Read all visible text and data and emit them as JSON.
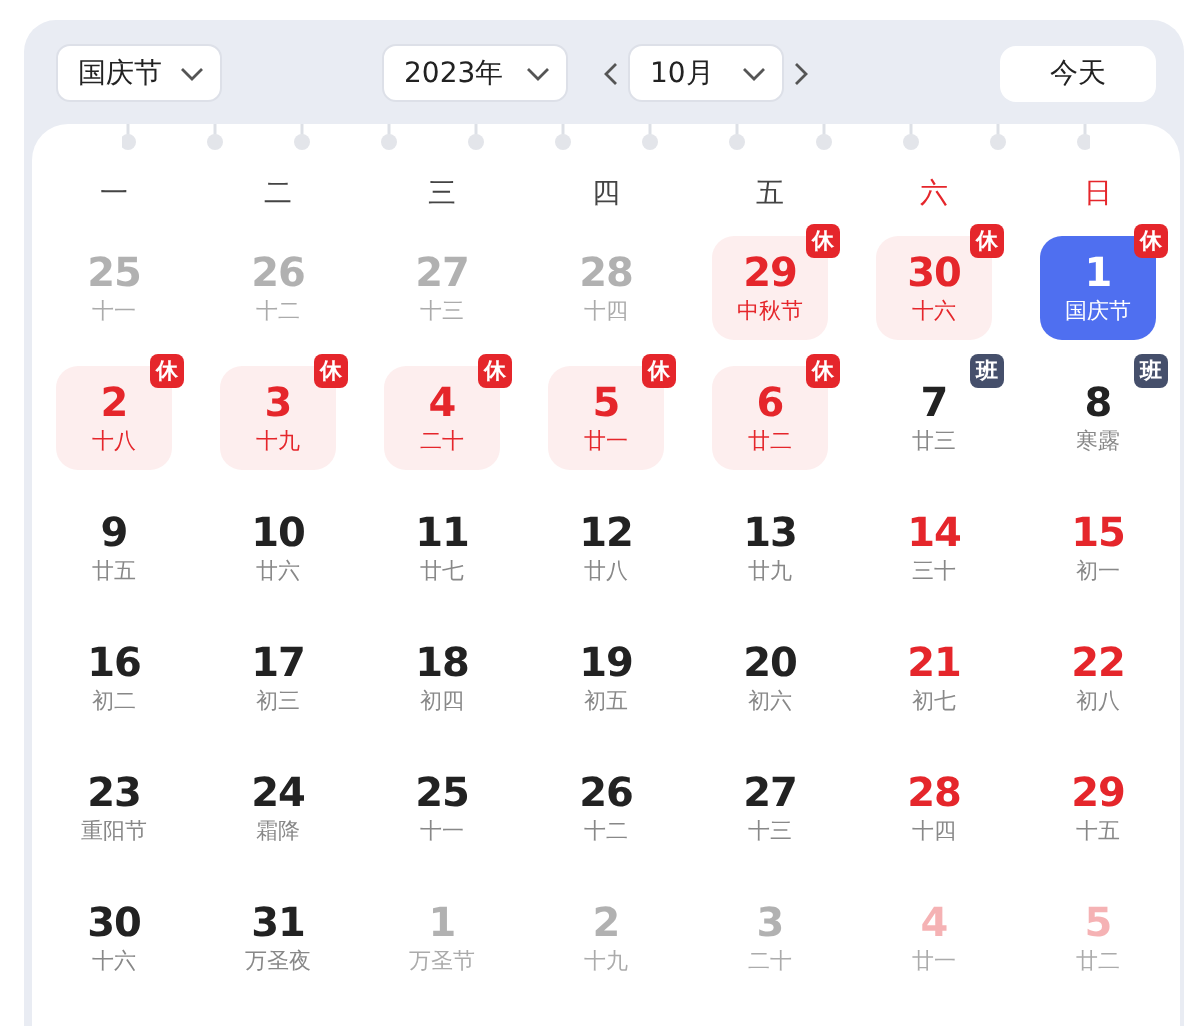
{
  "toolbar": {
    "holiday_select": "国庆节",
    "year_select": "2023年",
    "month_select": "10月",
    "today_button": "今天"
  },
  "weekdays": [
    {
      "label": "一",
      "weekend": false
    },
    {
      "label": "二",
      "weekend": false
    },
    {
      "label": "三",
      "weekend": false
    },
    {
      "label": "四",
      "weekend": false
    },
    {
      "label": "五",
      "weekend": false
    },
    {
      "label": "六",
      "weekend": true
    },
    {
      "label": "日",
      "weekend": true
    }
  ],
  "days": [
    {
      "day": "25",
      "lunar": "十一",
      "in_month": false,
      "weekend": false,
      "holiday": false,
      "selected": false
    },
    {
      "day": "26",
      "lunar": "十二",
      "in_month": false,
      "weekend": false,
      "holiday": false,
      "selected": false
    },
    {
      "day": "27",
      "lunar": "十三",
      "in_month": false,
      "weekend": false,
      "holiday": false,
      "selected": false
    },
    {
      "day": "28",
      "lunar": "十四",
      "in_month": false,
      "weekend": false,
      "holiday": false,
      "selected": false
    },
    {
      "day": "29",
      "lunar": "中秋节",
      "in_month": false,
      "weekend": false,
      "holiday": true,
      "selected": false,
      "badge": {
        "text": "休",
        "kind": "rest"
      }
    },
    {
      "day": "30",
      "lunar": "十六",
      "in_month": false,
      "weekend": true,
      "holiday": true,
      "selected": false,
      "badge": {
        "text": "休",
        "kind": "rest"
      }
    },
    {
      "day": "1",
      "lunar": "国庆节",
      "in_month": true,
      "weekend": true,
      "holiday": true,
      "selected": true,
      "badge": {
        "text": "休",
        "kind": "rest"
      }
    },
    {
      "day": "2",
      "lunar": "十八",
      "in_month": true,
      "weekend": false,
      "holiday": true,
      "selected": false,
      "badge": {
        "text": "休",
        "kind": "rest"
      }
    },
    {
      "day": "3",
      "lunar": "十九",
      "in_month": true,
      "weekend": false,
      "holiday": true,
      "selected": false,
      "badge": {
        "text": "休",
        "kind": "rest"
      }
    },
    {
      "day": "4",
      "lunar": "二十",
      "in_month": true,
      "weekend": false,
      "holiday": true,
      "selected": false,
      "badge": {
        "text": "休",
        "kind": "rest"
      }
    },
    {
      "day": "5",
      "lunar": "廿一",
      "in_month": true,
      "weekend": false,
      "holiday": true,
      "selected": false,
      "badge": {
        "text": "休",
        "kind": "rest"
      }
    },
    {
      "day": "6",
      "lunar": "廿二",
      "in_month": true,
      "weekend": false,
      "holiday": true,
      "selected": false,
      "badge": {
        "text": "休",
        "kind": "rest"
      }
    },
    {
      "day": "7",
      "lunar": "廿三",
      "in_month": true,
      "weekend": false,
      "holiday": false,
      "selected": false,
      "badge": {
        "text": "班",
        "kind": "work"
      }
    },
    {
      "day": "8",
      "lunar": "寒露",
      "in_month": true,
      "weekend": false,
      "holiday": false,
      "selected": false,
      "badge": {
        "text": "班",
        "kind": "work"
      }
    },
    {
      "day": "9",
      "lunar": "廿五",
      "in_month": true,
      "weekend": false,
      "holiday": false,
      "selected": false
    },
    {
      "day": "10",
      "lunar": "廿六",
      "in_month": true,
      "weekend": false,
      "holiday": false,
      "selected": false
    },
    {
      "day": "11",
      "lunar": "廿七",
      "in_month": true,
      "weekend": false,
      "holiday": false,
      "selected": false
    },
    {
      "day": "12",
      "lunar": "廿八",
      "in_month": true,
      "weekend": false,
      "holiday": false,
      "selected": false
    },
    {
      "day": "13",
      "lunar": "廿九",
      "in_month": true,
      "weekend": false,
      "holiday": false,
      "selected": false
    },
    {
      "day": "14",
      "lunar": "三十",
      "in_month": true,
      "weekend": true,
      "holiday": false,
      "selected": false
    },
    {
      "day": "15",
      "lunar": "初一",
      "in_month": true,
      "weekend": true,
      "holiday": false,
      "selected": false
    },
    {
      "day": "16",
      "lunar": "初二",
      "in_month": true,
      "weekend": false,
      "holiday": false,
      "selected": false
    },
    {
      "day": "17",
      "lunar": "初三",
      "in_month": true,
      "weekend": false,
      "holiday": false,
      "selected": false
    },
    {
      "day": "18",
      "lunar": "初四",
      "in_month": true,
      "weekend": false,
      "holiday": false,
      "selected": false
    },
    {
      "day": "19",
      "lunar": "初五",
      "in_month": true,
      "weekend": false,
      "holiday": false,
      "selected": false
    },
    {
      "day": "20",
      "lunar": "初六",
      "in_month": true,
      "weekend": false,
      "holiday": false,
      "selected": false
    },
    {
      "day": "21",
      "lunar": "初七",
      "in_month": true,
      "weekend": true,
      "holiday": false,
      "selected": false
    },
    {
      "day": "22",
      "lunar": "初八",
      "in_month": true,
      "weekend": true,
      "holiday": false,
      "selected": false
    },
    {
      "day": "23",
      "lunar": "重阳节",
      "in_month": true,
      "weekend": false,
      "holiday": false,
      "selected": false
    },
    {
      "day": "24",
      "lunar": "霜降",
      "in_month": true,
      "weekend": false,
      "holiday": false,
      "selected": false
    },
    {
      "day": "25",
      "lunar": "十一",
      "in_month": true,
      "weekend": false,
      "holiday": false,
      "selected": false
    },
    {
      "day": "26",
      "lunar": "十二",
      "in_month": true,
      "weekend": false,
      "holiday": false,
      "selected": false
    },
    {
      "day": "27",
      "lunar": "十三",
      "in_month": true,
      "weekend": false,
      "holiday": false,
      "selected": false
    },
    {
      "day": "28",
      "lunar": "十四",
      "in_month": true,
      "weekend": true,
      "holiday": false,
      "selected": false
    },
    {
      "day": "29",
      "lunar": "十五",
      "in_month": true,
      "weekend": true,
      "holiday": false,
      "selected": false
    },
    {
      "day": "30",
      "lunar": "十六",
      "in_month": true,
      "weekend": false,
      "holiday": false,
      "selected": false
    },
    {
      "day": "31",
      "lunar": "万圣夜",
      "in_month": true,
      "weekend": false,
      "holiday": false,
      "selected": false
    },
    {
      "day": "1",
      "lunar": "万圣节",
      "in_month": false,
      "weekend": false,
      "holiday": false,
      "selected": false
    },
    {
      "day": "2",
      "lunar": "十九",
      "in_month": false,
      "weekend": false,
      "holiday": false,
      "selected": false
    },
    {
      "day": "3",
      "lunar": "二十",
      "in_month": false,
      "weekend": false,
      "holiday": false,
      "selected": false
    },
    {
      "day": "4",
      "lunar": "廿一",
      "in_month": false,
      "weekend": true,
      "holiday": false,
      "selected": false
    },
    {
      "day": "5",
      "lunar": "廿二",
      "in_month": false,
      "weekend": true,
      "holiday": false,
      "selected": false
    }
  ]
}
